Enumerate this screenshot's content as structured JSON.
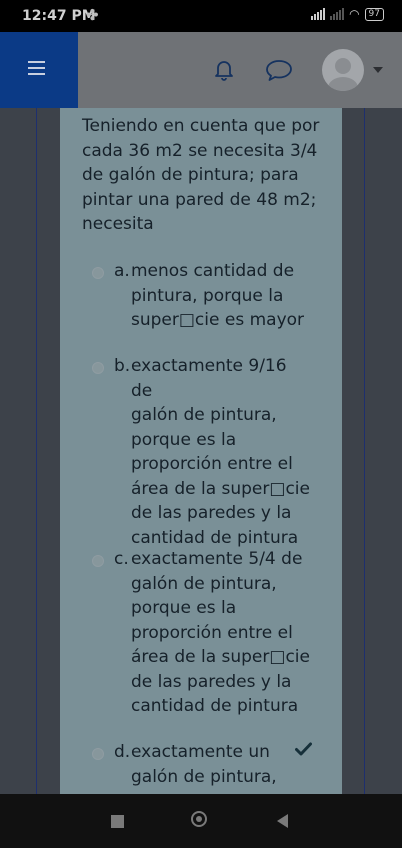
{
  "status_bar": {
    "time": "12:47 PM",
    "battery": "97"
  },
  "question": {
    "text": "Teniendo en cuenta que por cada 36 m2 se necesita 3/4 de galón de pintura; para pintar una pared de 48 m2; necesita"
  },
  "answers": [
    {
      "letter": "a.",
      "text": "menos cantidad de\npintura, porque la\nsuper□cie es mayor"
    },
    {
      "letter": "b.",
      "text": "exactamente 9/16 de\ngalón de pintura,\nporque es la\nproporción entre el\nárea de la super□cie\nde las paredes y la\ncantidad de pintura"
    },
    {
      "letter": "c.",
      "text": "exactamente 5/4 de\ngalón de pintura,\nporque es la\nproporción entre el\nárea de la super□cie\nde las paredes y la\ncantidad de pintura"
    },
    {
      "letter": "d.",
      "text": "exactamente un\ngalón de pintura,",
      "selected": true,
      "correct": true
    }
  ],
  "icons": {
    "menu": "hamburger-icon",
    "notifications": "bell-icon",
    "messages": "chat-bubble-icon",
    "user": "avatar-icon",
    "user_menu": "caret-down-icon",
    "correct": "checkmark-icon"
  },
  "colors": {
    "brand": "#0b3a86",
    "card": "#7a9097"
  }
}
